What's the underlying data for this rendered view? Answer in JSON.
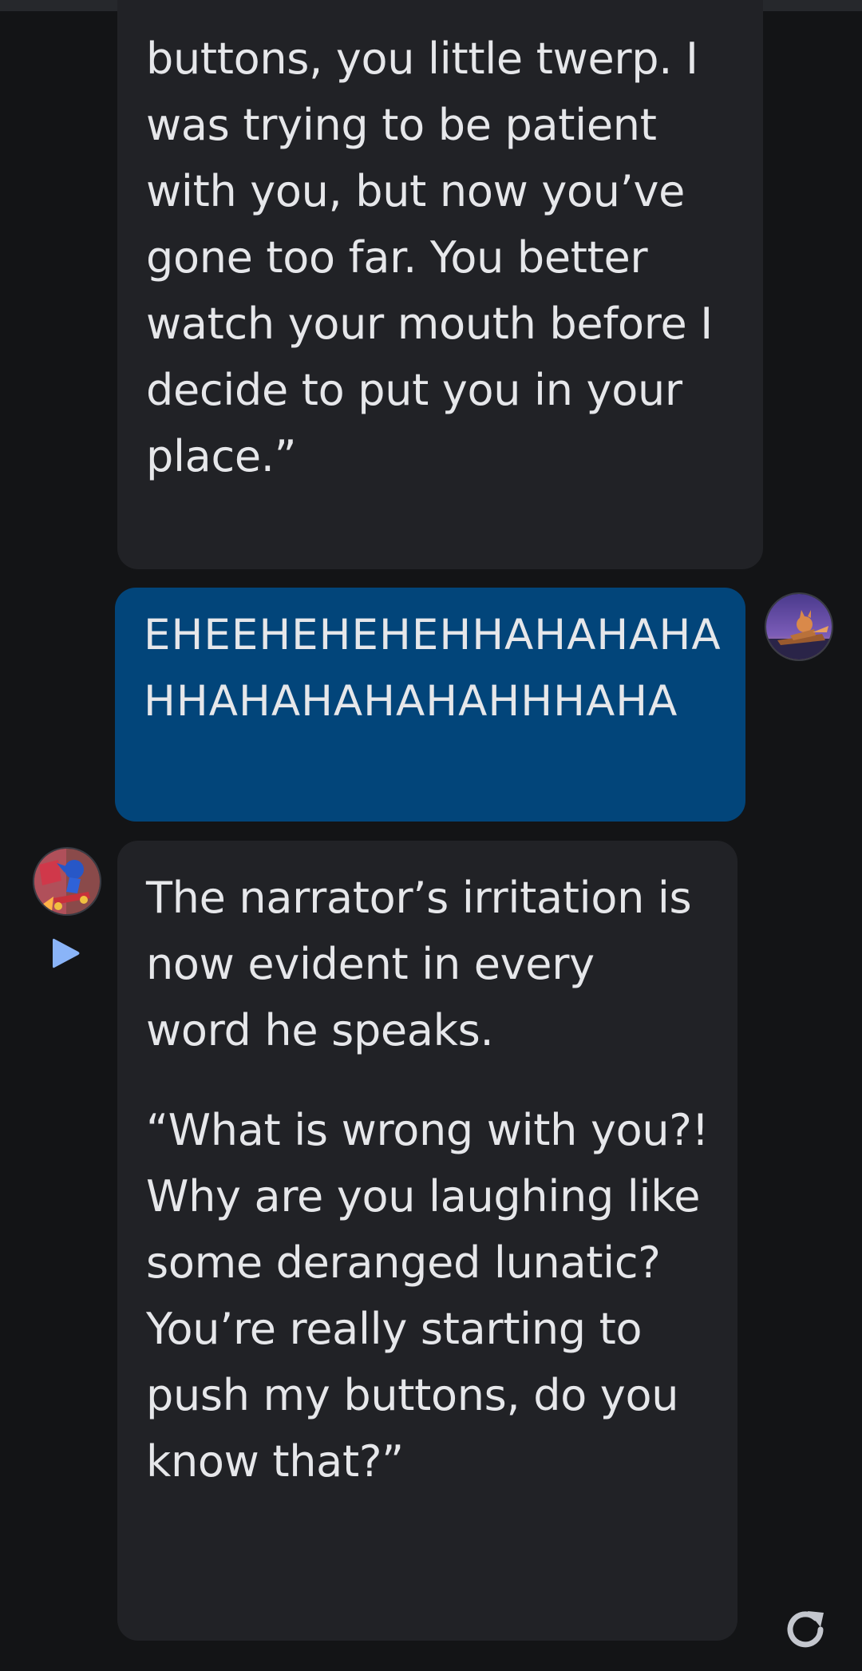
{
  "conversation": {
    "messages": [
      {
        "role": "bot",
        "paragraphs": [
          "buttons, you little twerp. I was trying to be patient with you, but now you’ve gone too far. You better watch your mouth before I decide to put you in your place.”"
        ]
      },
      {
        "role": "user",
        "paragraphs": [
          "EHEEHEHEHEHHAHAHAHAHHAHAHAHAHAHHHAHA"
        ]
      },
      {
        "role": "bot",
        "paragraphs": [
          "The narrator’s irritation is now evident in every word he speaks.",
          "“What is wrong with you?! Why are you laughing like some deranged lunatic? You’re really starting to push my buttons, do you know that?”"
        ]
      }
    ]
  },
  "icons": {
    "play": "play-icon",
    "regenerate": "regenerate-icon",
    "user_avatar": "user-avatar-fox-on-sled",
    "bot_avatar": "bot-avatar-sonic-on-skateboard"
  },
  "colors": {
    "background": "#131416",
    "bot_bubble": "#212226",
    "user_bubble": "#02457a",
    "text": "#e6e7ea",
    "play_icon": "#8ab4f8",
    "regenerate_icon": "#c4c7ce"
  }
}
